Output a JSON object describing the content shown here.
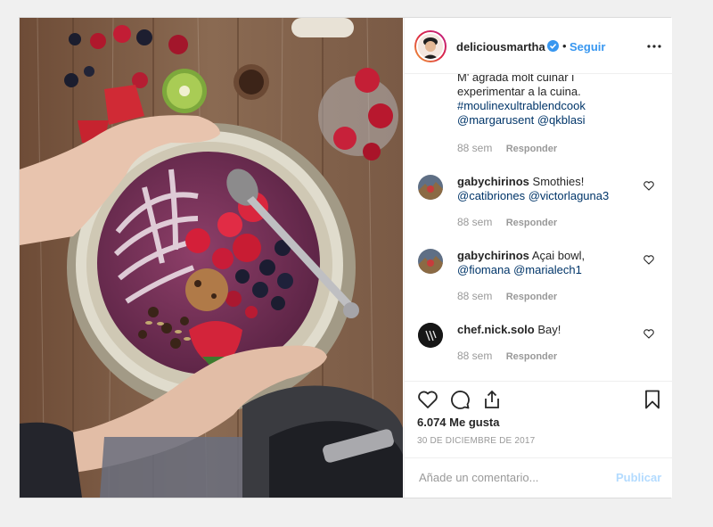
{
  "post": {
    "username": "deliciousmartha",
    "dot": "•",
    "follow_label": "Seguir",
    "image_alt": "Açaí bowl with berries held by hands on wooden table"
  },
  "caption": {
    "line1": "M' agrada molt cuinar i",
    "line2": "experimentar a la cuina.",
    "hashtag": "#moulinexultrablendcook",
    "mention1": "@margarusent",
    "mention2": "@qkblasi",
    "age": "88 sem",
    "reply_label": "Responder"
  },
  "comments": [
    {
      "user": "gabychirinos",
      "text": "Smothies!",
      "mention1": "@catibriones",
      "mention2": "@victorlaguna3",
      "age": "88 sem",
      "reply_label": "Responder"
    },
    {
      "user": "gabychirinos",
      "text": "Açai bowl,",
      "mention1": "@fiomana",
      "mention2": "@marialech1",
      "age": "88 sem",
      "reply_label": "Responder"
    },
    {
      "user": "chef.nick.solo",
      "text": "Bay!",
      "age": "88 sem",
      "reply_label": "Responder"
    }
  ],
  "actions": {
    "likes": "6.074 Me gusta",
    "date": "30 DE DICIEMBRE DE 2017"
  },
  "add_comment": {
    "placeholder": "Añade un comentario...",
    "publish_label": "Publicar"
  },
  "colors": {
    "link": "#003569",
    "follow": "#3897f0",
    "publish_disabled": "#b3dbff",
    "muted": "#999999"
  },
  "icons": [
    "verified-badge-icon",
    "more-options-icon",
    "heart-icon",
    "comment-icon",
    "share-icon",
    "bookmark-icon"
  ]
}
